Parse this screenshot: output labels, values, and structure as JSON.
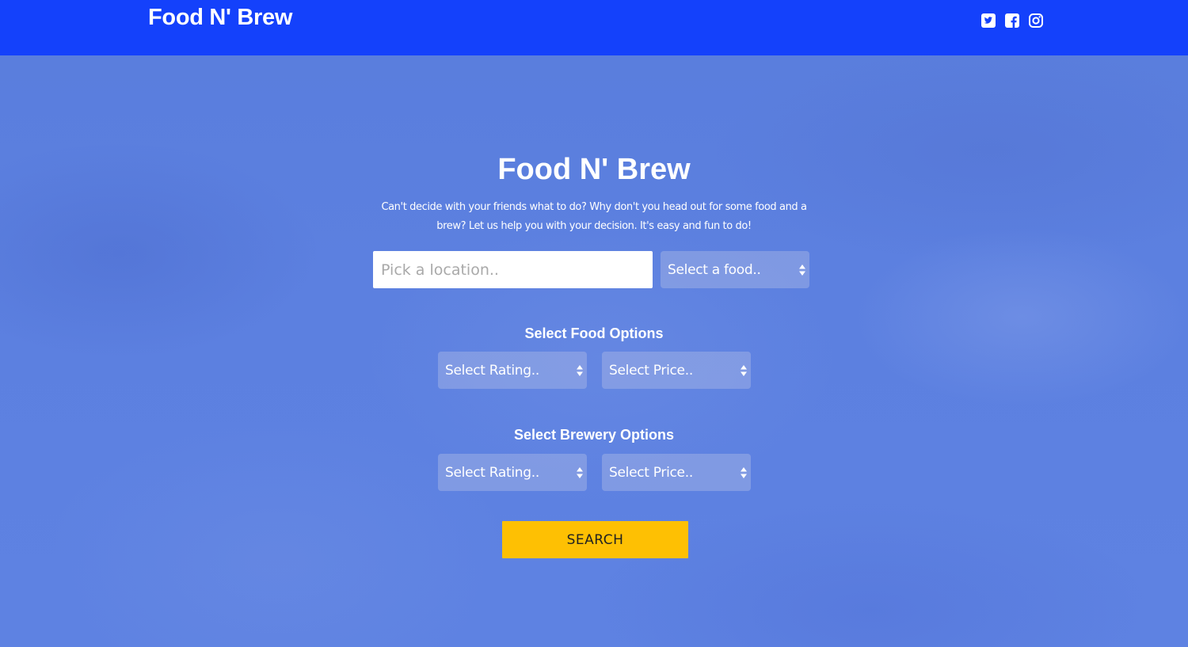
{
  "navbar": {
    "brand": "Food N' Brew",
    "social": [
      {
        "icon": "twitter-icon"
      },
      {
        "icon": "facebook-icon"
      },
      {
        "icon": "instagram-icon"
      }
    ]
  },
  "hero": {
    "title": "Food N' Brew",
    "description": "Can't decide with your friends what to do? Why don't you head out for some food and a brew? Let us help you with your decision. It's easy and fun to do!"
  },
  "search": {
    "location_placeholder": "Pick a location..",
    "food_select": "Select a food.."
  },
  "food_options": {
    "title": "Select Food Options",
    "rating_select": "Select Rating..",
    "price_select": "Select Price.."
  },
  "brewery_options": {
    "title": "Select Brewery Options",
    "rating_select": "Select Rating..",
    "price_select": "Select Price.."
  },
  "search_button": "SEARCH",
  "colors": {
    "navbar": "#1441fb",
    "background": "#5b7fdf",
    "button": "#fec003"
  }
}
